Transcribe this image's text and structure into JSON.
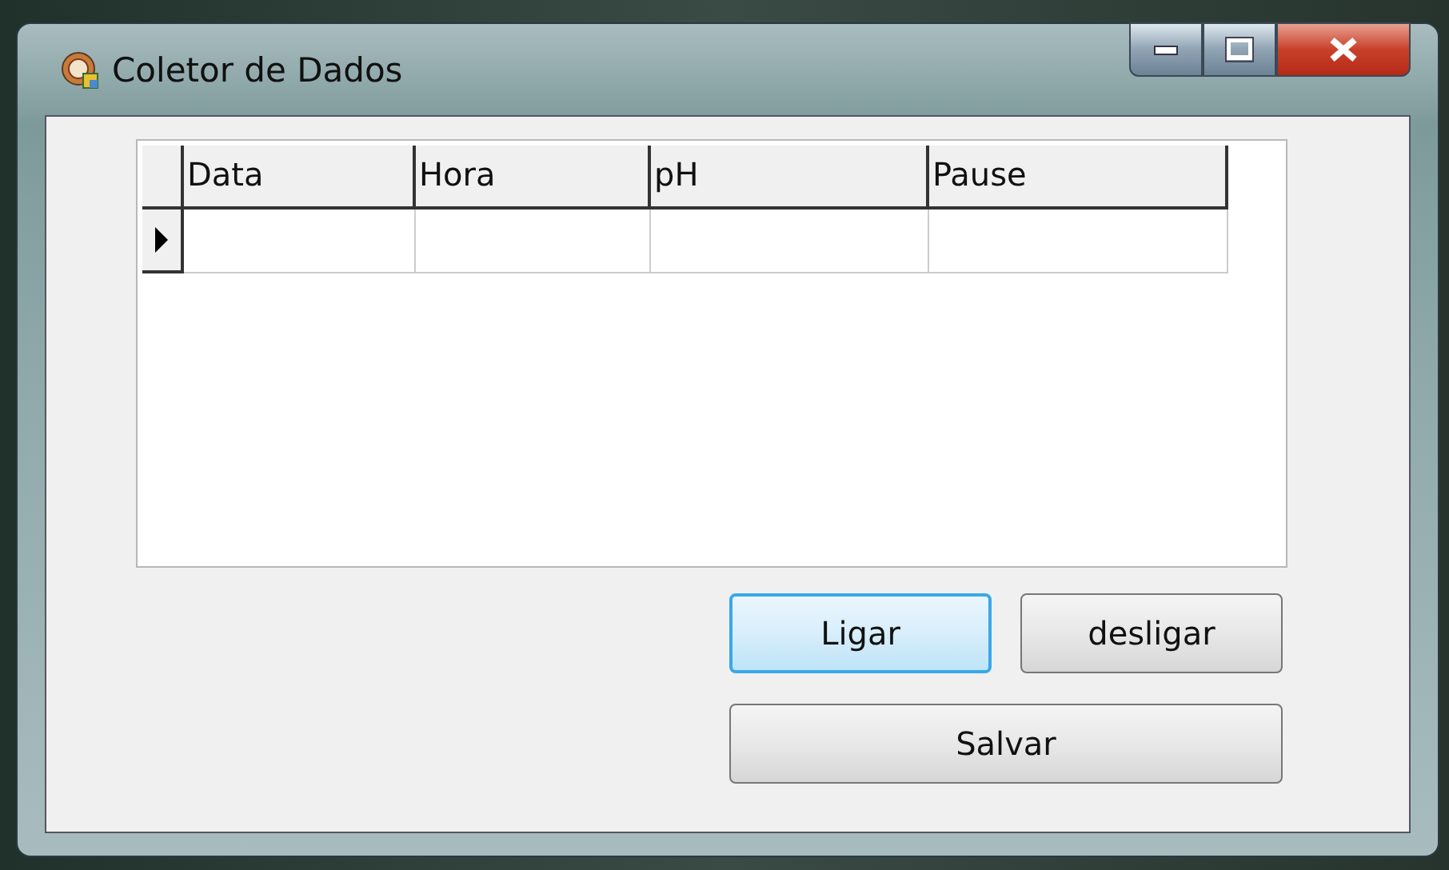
{
  "window": {
    "title": "Coletor de Dados"
  },
  "grid": {
    "columns": [
      "Data",
      "Hora",
      "pH",
      "Pause"
    ],
    "rows": [
      {
        "current": true,
        "cells": [
          "",
          "",
          "",
          ""
        ]
      }
    ]
  },
  "buttons": [
    {
      "label": "Ligar",
      "focused": true,
      "wide": false
    },
    {
      "label": "desligar",
      "focused": false,
      "wide": false
    },
    {
      "label": "Salvar",
      "focused": false,
      "wide": true
    }
  ]
}
